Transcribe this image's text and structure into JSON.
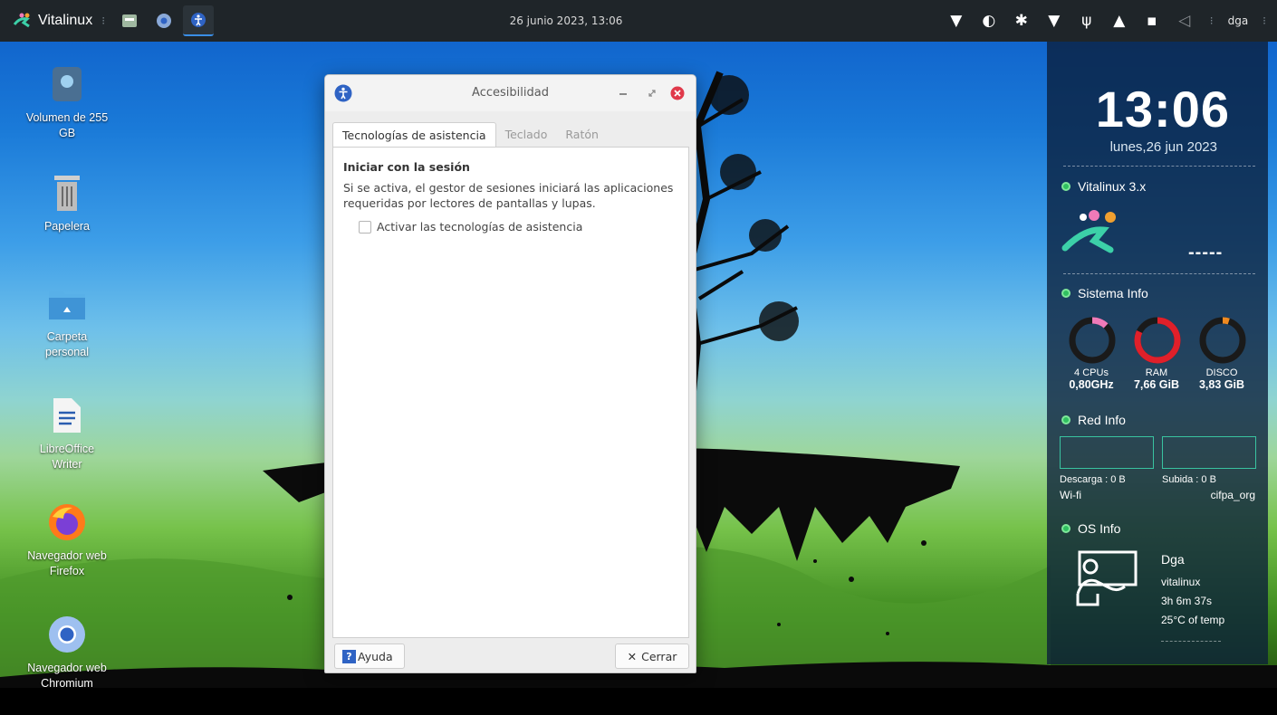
{
  "panel": {
    "brand": "Vitalinux",
    "datetime": "26 junio 2023, 13:06",
    "user": "dga"
  },
  "desktop_icons": [
    {
      "label": "Volumen de 255\nGB",
      "icon": "drive-icon"
    },
    {
      "label": "Papelera",
      "icon": "trash-icon"
    },
    {
      "label": "Carpeta\npersonal",
      "icon": "home-folder-icon"
    },
    {
      "label": "LibreOffice\nWriter",
      "icon": "writer-icon"
    },
    {
      "label": "Navegador web\nFirefox",
      "icon": "firefox-icon"
    },
    {
      "label": "Navegador web\nChromium",
      "icon": "chromium-icon"
    }
  ],
  "dialog": {
    "title": "Accesibilidad",
    "tabs": [
      "Tecnologías de asistencia",
      "Teclado",
      "Ratón"
    ],
    "active_tab": "Tecnologías de asistencia",
    "section_title": "Iniciar con la sesión",
    "section_description": "Si se activa, el gestor de sesiones iniciará las aplicaciones requeridas por lectores de pantallas y lupas.",
    "checkbox_label": "Activar las tecnologías de asistencia",
    "checkbox_checked": false,
    "help_button": "Ayuda",
    "close_button": "Cerrar"
  },
  "conky": {
    "time": "13:06",
    "date": "lunes,26 jun 2023",
    "vitalinux": {
      "title": "Vitalinux 3.x",
      "value": "-----"
    },
    "sistema": {
      "title": "Sistema Info",
      "gauges": [
        {
          "label": "4 CPUs",
          "value": "0,80GHz",
          "color": "#f07ab8",
          "fraction": 0.12
        },
        {
          "label": "RAM",
          "value": "7,66 GiB",
          "color": "#e0202a",
          "fraction": 0.82
        },
        {
          "label": "DISCO",
          "value": "3,83 GiB",
          "color": "#f08a20",
          "fraction": 0.05
        }
      ]
    },
    "red": {
      "title": "Red Info",
      "download": "Descarga : 0 B",
      "upload": "Subida : 0 B",
      "interface": "Wi-fi",
      "network": "cifpa_org"
    },
    "os": {
      "title": "OS Info",
      "user": "Dga",
      "host": "vitalinux",
      "uptime": "3h 6m 37s",
      "temp": "25°C of temp"
    }
  },
  "colors": {
    "panel_bg": "#1f2529",
    "accent_green": "#30c060",
    "net_box": "#39c3a0",
    "help_blue": "#2f63c4",
    "close_red": "#e0394a"
  }
}
